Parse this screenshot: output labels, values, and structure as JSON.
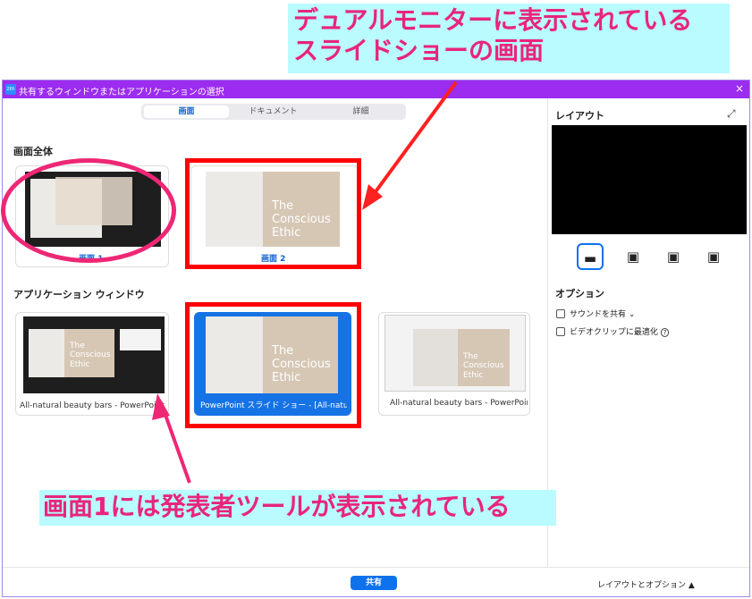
{
  "annotations": {
    "top_callout": [
      "デュアルモニターに表示されている",
      "スライドショーの画面"
    ],
    "bottom_callout": "画面1には発表者ツールが表示されている"
  },
  "window": {
    "title": "共有するウィンドウまたはアプリケーションの選択",
    "logo": "zm",
    "close_icon": "×"
  },
  "tabs": [
    "画面",
    "ドキュメント",
    "詳細"
  ],
  "sections": {
    "screens_title": "画面全体",
    "apps_title": "アプリケーション ウィンドウ"
  },
  "screens": [
    {
      "label": "画面 1"
    },
    {
      "label": "画面 2",
      "slide_text": "The\nConscious\nEthic"
    }
  ],
  "apps": [
    {
      "label": "All-natural beauty bars - PowerPoint 発",
      "slide_text": "The\nConscious\nEthic"
    },
    {
      "label": "PowerPoint スライド ショー - [All-natural ...",
      "slide_text": "The\nConscious\nEthic",
      "selected": true
    },
    {
      "label": "All-natural beauty bars - PowerPoint",
      "slide_text": "The\nConscious\nEthic"
    }
  ],
  "right_panel": {
    "layout_title": "レイアウト",
    "expand_icon": "⤢",
    "options_title": "オプション",
    "options": [
      {
        "label": "サウンドを共有",
        "suffix": "⌄",
        "checked": false
      },
      {
        "label": "ビデオクリップに最適化",
        "suffix": "?",
        "checked": false
      }
    ]
  },
  "footer": {
    "share_label": "共有",
    "layout_options_label": "レイアウトとオプション ▲"
  },
  "colors": {
    "accent": "#0e72ed",
    "titlebar": "#9b2cf0",
    "annotation_red": "#ff0000",
    "annotation_pink": "#ee2775",
    "callout_bg": "#b9fbff"
  }
}
